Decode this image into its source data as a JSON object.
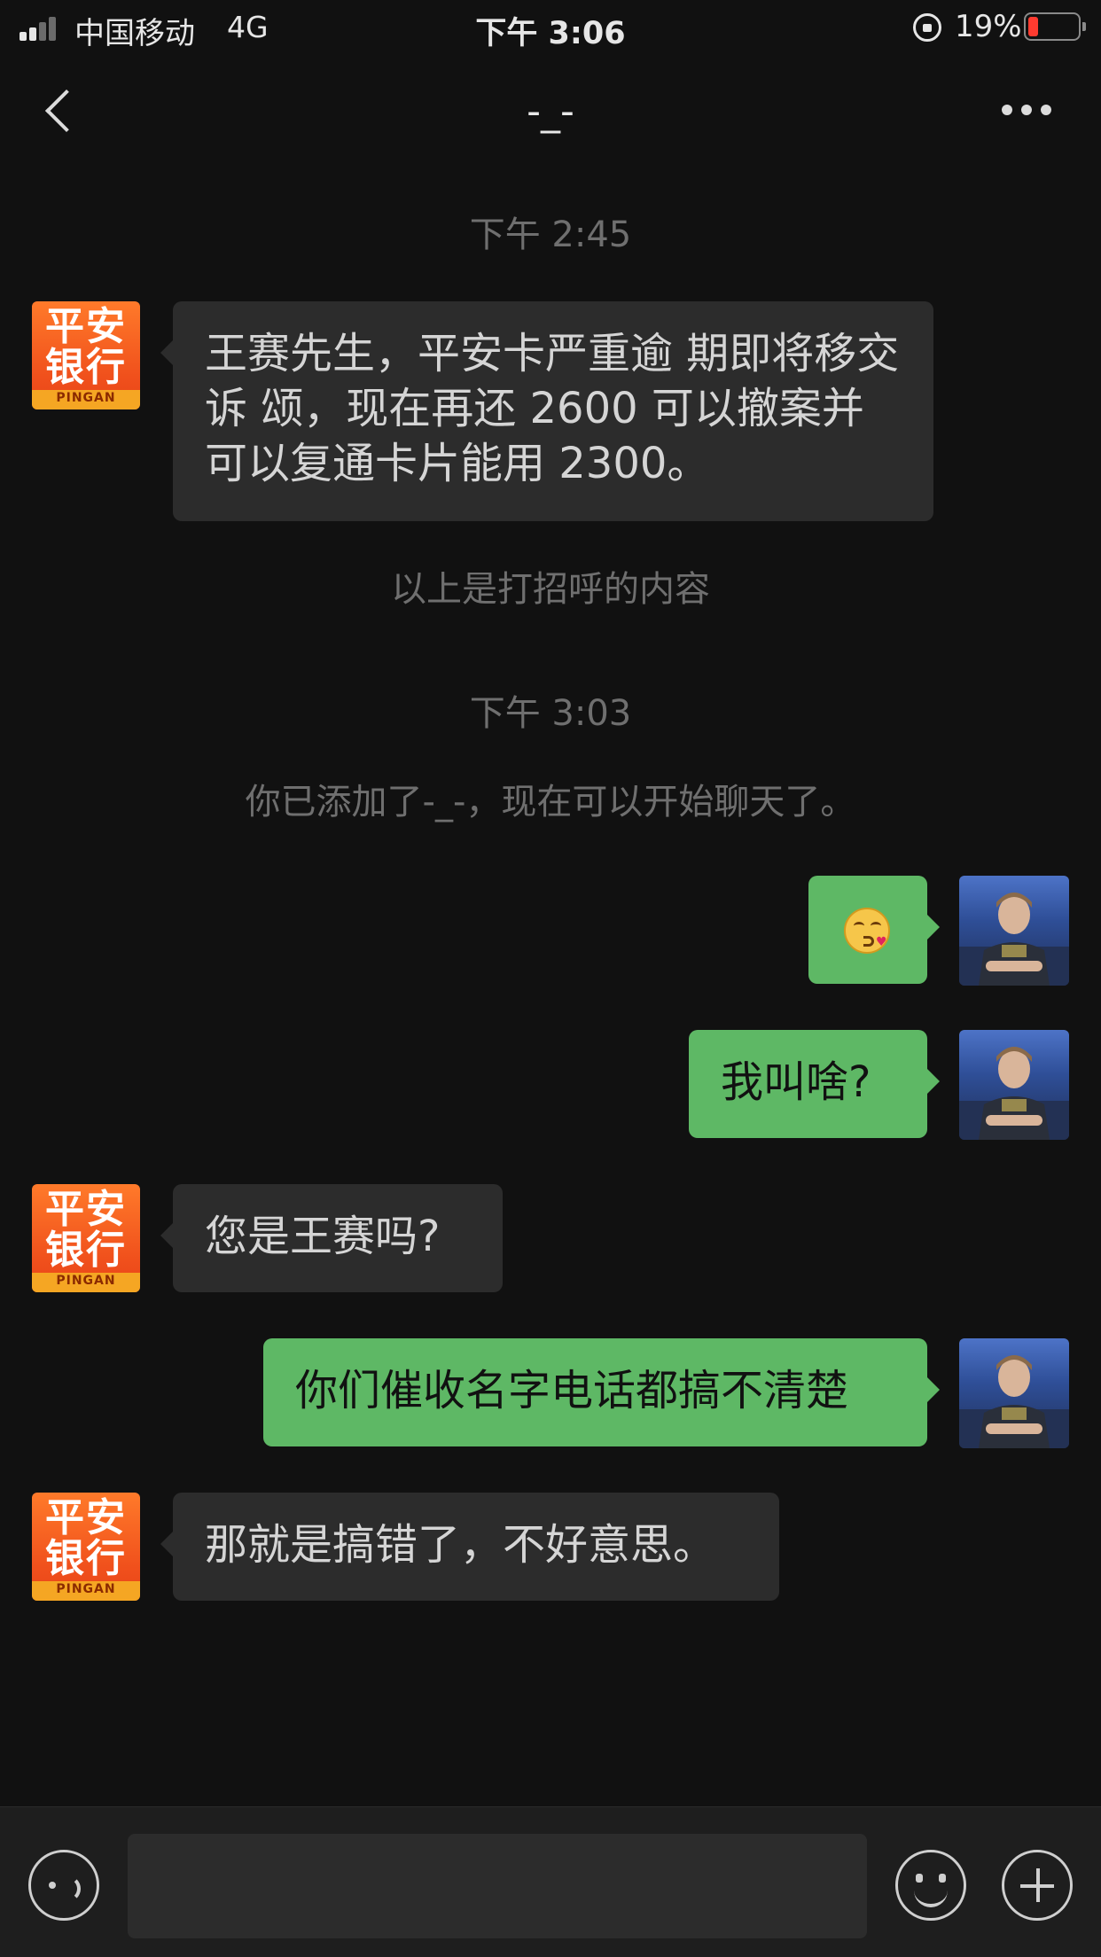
{
  "status_bar": {
    "carrier": "中国移动",
    "network": "4G",
    "time": "下午 3:06",
    "battery_percent": "19%",
    "battery_level": 0.19,
    "signal_bars": 2
  },
  "nav": {
    "title": "-_-",
    "back_icon": "chevron-left-icon",
    "more_icon": "more-dots-icon"
  },
  "chat": {
    "timestamp_1": "下午 2:45",
    "greeting_note": "以上是打招呼的内容",
    "timestamp_2": "下午 3:03",
    "added_note": "你已添加了-_-，现在可以开始聊天了。",
    "bank_avatar_text": "平安\n银行",
    "bank_avatar_brand": "PINGAN",
    "messages": [
      {
        "from": "bank",
        "text": "王赛先生，平安卡严重逾 期即将移交诉 颂，现在再还 2600 可以撤案并可以复通卡片能用 2300。"
      },
      {
        "from": "me",
        "type": "emoji",
        "emoji": "kissing-face-emoji"
      },
      {
        "from": "me",
        "text": "我叫啥?"
      },
      {
        "from": "bank",
        "text": "您是王赛吗?"
      },
      {
        "from": "me",
        "text": "你们催收名字电话都搞不清楚"
      },
      {
        "from": "bank",
        "text": "那就是搞错了，不好意思。"
      }
    ]
  },
  "input_bar": {
    "voice_icon": "voice-icon",
    "emoji_icon": "emoji-icon",
    "add_icon": "plus-circle-icon"
  },
  "colors": {
    "background": "#111111",
    "incoming_bubble": "#2c2c2c",
    "outgoing_bubble": "#5eb865",
    "system_text": "#6f6f6f",
    "battery_low": "#ff3b30"
  }
}
